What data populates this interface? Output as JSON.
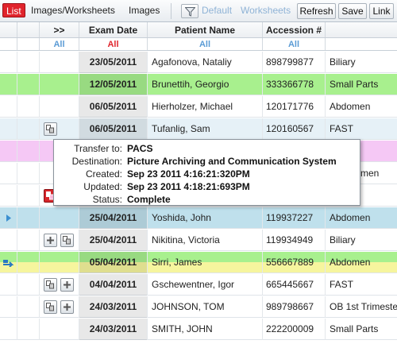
{
  "toolbar": {
    "tabs": [
      "List",
      "Images/Worksheets",
      "Images"
    ],
    "filters": [
      "Default",
      "Worksheets"
    ],
    "buttons": {
      "refresh": "Refresh",
      "save": "Save",
      "link": "Link"
    },
    "filter_icon": "funnel-icon"
  },
  "columns": {
    "expand": ">>",
    "exam_date": "Exam Date",
    "patient_name": "Patient Name",
    "accession": "Accession #",
    "filter_all": "All"
  },
  "rows": [
    {
      "date": "23/05/2011",
      "patient": "Agafonova, Nataliy",
      "accession": "898799877",
      "region": "Biliary"
    },
    {
      "date": "12/05/2011",
      "patient": "Brunettih, Georgio",
      "accession": "333366778",
      "region": "Small Parts"
    },
    {
      "date": "06/05/2011",
      "patient": "Hierholzer, Michael",
      "accession": "120171776",
      "region": "Abdomen"
    },
    {
      "date": "06/05/2011",
      "patient": "Tufanlig, Sam",
      "accession": "120160567",
      "region": "FAST"
    },
    {
      "date": "",
      "patient": "",
      "accession": "",
      "region": ""
    },
    {
      "date": "",
      "patient": "",
      "accession": "",
      "region": "men"
    },
    {
      "date": "",
      "patient": "",
      "accession": "",
      "region": ""
    },
    {
      "date": "25/04/2011",
      "patient": "Yoshida, John",
      "accession": "119937227",
      "region": "Abdomen"
    },
    {
      "date": "25/04/2011",
      "patient": "Nikitina, Victoria",
      "accession": "119934949",
      "region": "Biliary"
    },
    {
      "date": "05/04/2011",
      "patient": "Sirri, James",
      "accession": "556667889",
      "region": "Abdomen"
    },
    {
      "date": "04/04/2011",
      "patient": "Gschewentner, Igor",
      "accession": "665445667",
      "region": "FAST"
    },
    {
      "date": "24/03/2011",
      "patient": "JOHNSON, TOM",
      "accession": "989798667",
      "region": "OB 1st Trimeste"
    },
    {
      "date": "24/03/2011",
      "patient": "SMITH, JOHN",
      "accession": "222200009",
      "region": "Small Parts"
    }
  ],
  "row_colors": {
    "green": "#a8f08e",
    "pink": "#f5c8f5",
    "blue": "#bfe0ec",
    "yellow": "#f6f59e",
    "accent_red": "#e0242c",
    "link_blue": "#5a9bd5"
  },
  "tooltip": {
    "transfer_to_label": "Transfer to:",
    "transfer_to": "PACS",
    "destination_label": "Destination:",
    "destination": "Picture Archiving and Communication System",
    "created_label": "Created:",
    "created": "Sep 23 2011  4:16:21:320PM",
    "updated_label": "Updated:",
    "updated": "Sep 23 2011  4:18:21:693PM",
    "status_label": "Status:",
    "status": "Complete"
  },
  "row_icons": [
    "transfer-icon",
    "transfer-error-icon",
    "row-pointer-icon",
    "arrow-transfer-icon"
  ]
}
